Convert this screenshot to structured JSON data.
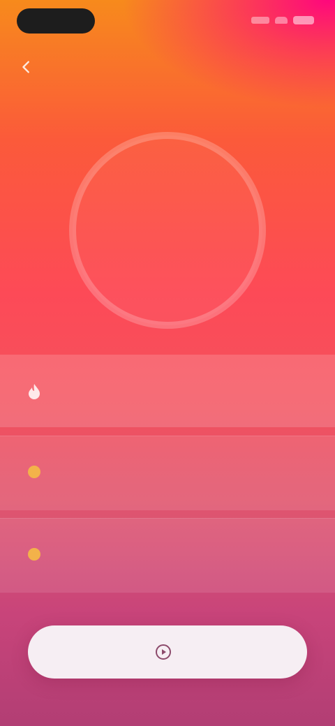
{
  "status_bar": {
    "time": ""
  },
  "nav": {
    "title": "",
    "back_icon": "chevron-left-icon"
  },
  "timer": {
    "value": "",
    "ring_color": "#ffffff"
  },
  "primary_card": {
    "icon": "flame-icon",
    "title": "",
    "subtitle": "",
    "value": ""
  },
  "rows": [
    {
      "icon": "sun-icon",
      "title": "",
      "subtitle": "",
      "value": ""
    },
    {
      "icon": "sun-icon",
      "title": "",
      "subtitle": "",
      "value": ""
    }
  ],
  "action_button": {
    "icon": "play-icon",
    "label": ""
  },
  "colors": {
    "accent_orange": "#f78a1c",
    "accent_pink": "#ff0082",
    "accent_red": "#fd4a57",
    "accent_magenta": "#b23e74",
    "button_bg": "#f6eef3",
    "icon_gold": "#f3b24a"
  }
}
